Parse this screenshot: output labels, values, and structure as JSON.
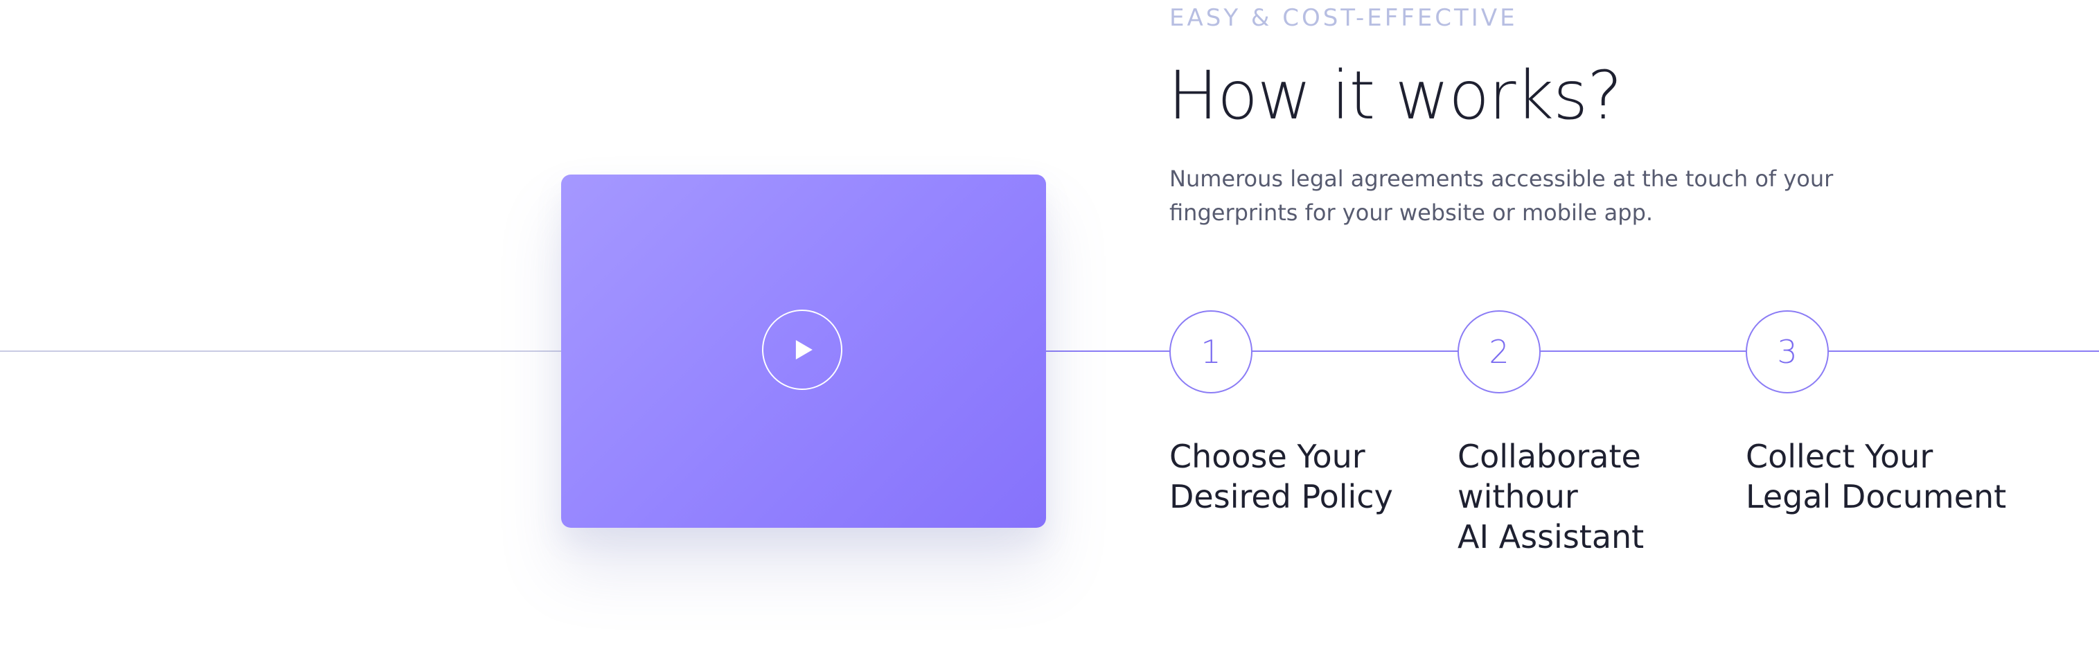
{
  "section": {
    "eyebrow": "EASY & COST-EFFECTIVE",
    "title": "How it works?",
    "description": "Numerous legal agreements accessible at the touch of your fingerprints for your website or mobile app."
  },
  "video": {
    "play_icon": "play-icon"
  },
  "steps": [
    {
      "number": "1",
      "title": "Choose Your\nDesired Policy"
    },
    {
      "number": "2",
      "title": "Collaborate\nwithour\nAI Assistant"
    },
    {
      "number": "3",
      "title": "Collect Your\nLegal Document"
    }
  ],
  "colors": {
    "accent": "#8b7cf5",
    "video_gradient_start": "#a598ff",
    "video_gradient_end": "#8672fb",
    "eyebrow": "#b7bee2",
    "title": "#1e2030",
    "body_text": "#575b70"
  }
}
